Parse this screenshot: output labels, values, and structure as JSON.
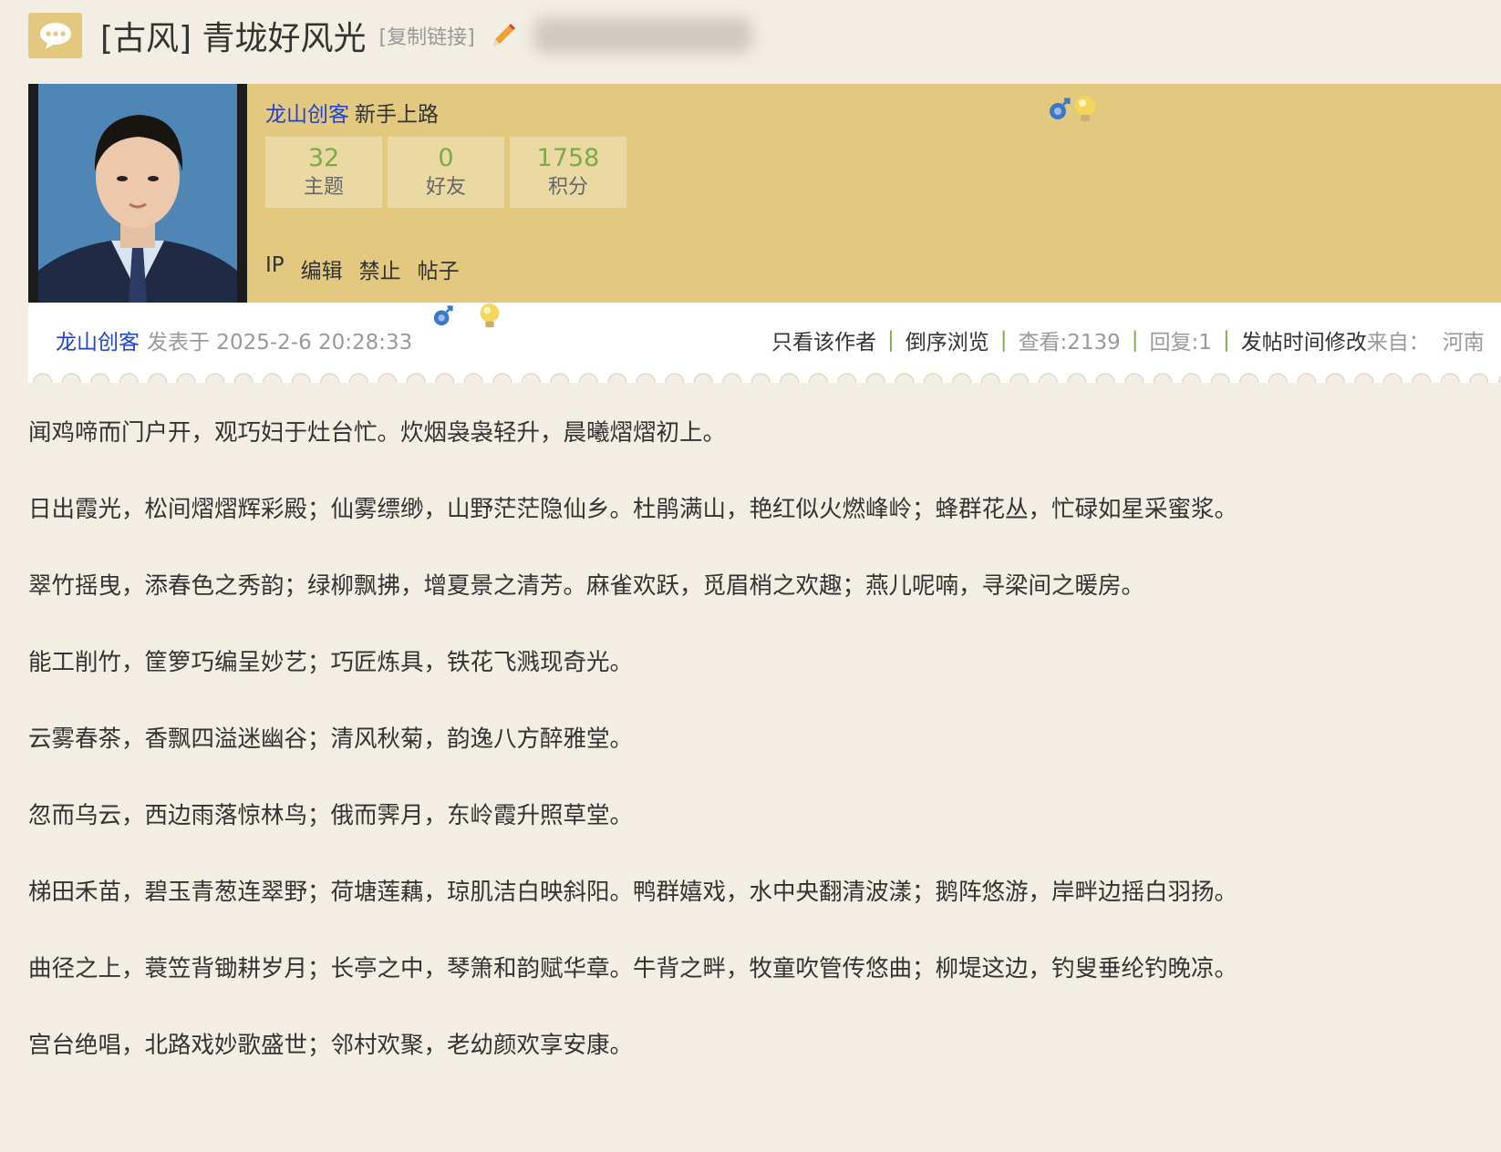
{
  "thread": {
    "title": "[古风] 青垅好风光",
    "copy_link": "[复制链接]"
  },
  "author_card": {
    "name": "龙山创客",
    "rank": "新手上路",
    "stats": [
      {
        "value": "32",
        "label": "主题"
      },
      {
        "value": "0",
        "label": "好友"
      },
      {
        "value": "1758",
        "label": "积分"
      }
    ],
    "admin_links": [
      "IP",
      "编辑",
      "禁止",
      "帖子"
    ]
  },
  "post_meta": {
    "author": "龙山创客",
    "posted_at": "发表于 2025-2-6 20:28:33",
    "only_author": "只看该作者",
    "reverse": "倒序浏览",
    "views": "查看:2139",
    "replies": "回复:1",
    "edit_time": "发帖时间修改",
    "from_label": "来自：",
    "from_value": "河南"
  },
  "post_body": {
    "paragraphs": [
      "闻鸡啼而门户开，观巧妇于灶台忙。炊烟袅袅轻升，晨曦熠熠初上。",
      "日出霞光，松间熠熠辉彩殿；仙雾缥缈，山野茫茫隐仙乡。杜鹃满山，艳红似火燃峰岭；蜂群花丛，忙碌如星采蜜浆。",
      "翠竹摇曳，添春色之秀韵；绿柳飘拂，增夏景之清芳。麻雀欢跃，觅眉梢之欢趣；燕儿呢喃，寻梁间之暖房。",
      "能工削竹，筐箩巧编呈妙艺；巧匠炼具，铁花飞溅现奇光。",
      "云雾春茶，香飘四溢迷幽谷；清风秋菊，韵逸八方醉雅堂。",
      "忽而乌云，西边雨落惊林鸟；俄而霁月，东岭霞升照草堂。",
      "梯田禾苗，碧玉青葱连翠野；荷塘莲藕，琼肌洁白映斜阳。鸭群嬉戏，水中央翻清波漾；鹅阵悠游，岸畔边摇白羽扬。",
      "曲径之上，蓑笠背锄耕岁月；长亭之中，琴箫和韵赋华章。牛背之畔，牧童吹管传悠曲；柳堤这边，钓叟垂纶钓晚凉。",
      "宫台绝唱，北路戏妙歌盛世；邻村欢聚，老幼颜欢享安康。"
    ]
  },
  "colors": {
    "page_bg": "#f2eee3",
    "card_bg": "#e2c97f",
    "stat_bg": "#ead9a3",
    "stat_number": "#7fa84a",
    "link_blue": "#2244cc",
    "accent_orange": "#f08a24"
  },
  "icons": {
    "title": "chat-bubble-icon",
    "edit": "pencil-icon",
    "medals": [
      "male-icon",
      "lightbulb-icon"
    ]
  }
}
